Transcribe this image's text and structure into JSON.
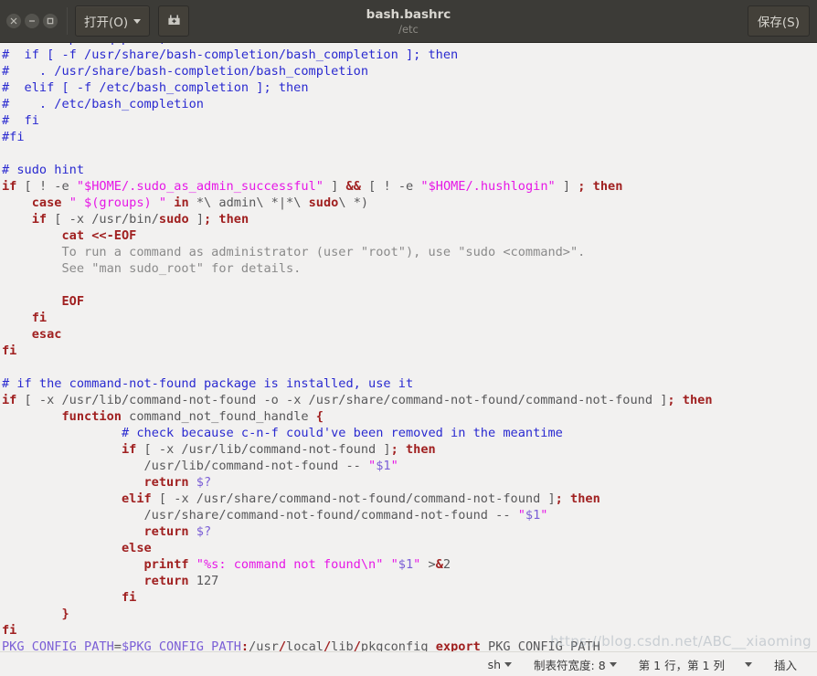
{
  "titlebar": {
    "window_controls": [
      {
        "name": "close",
        "glyph": "×"
      },
      {
        "name": "minimize",
        "glyph": "−"
      },
      {
        "name": "maximize",
        "glyph": "□"
      }
    ],
    "open_button": "打开(O)",
    "save_as_icon": "save-as-icon",
    "title": "bash.bashrc",
    "subtitle": "/etc",
    "save_button": "保存(S)"
  },
  "statusbar": {
    "language": "sh",
    "tab_width": "制表符宽度: 8",
    "cursor_position": "第 1 行，第 1 列",
    "insert_mode": "插入"
  },
  "watermark": "https://blog.csdn.net/ABC__xiaoming",
  "editor": {
    "lines": [
      [
        {
          "t": "#if ! shopt -oq posix; then",
          "c": "cm"
        }
      ],
      [
        {
          "t": "#  if [ -f /usr/share/bash-completion/bash_completion ]; then",
          "c": "cm"
        }
      ],
      [
        {
          "t": "#    . /usr/share/bash-completion/bash_completion",
          "c": "cm"
        }
      ],
      [
        {
          "t": "#  elif [ -f /etc/bash_completion ]; then",
          "c": "cm"
        }
      ],
      [
        {
          "t": "#    . /etc/bash_completion",
          "c": "cm"
        }
      ],
      [
        {
          "t": "#  fi",
          "c": "cm"
        }
      ],
      [
        {
          "t": "#fi",
          "c": "cm"
        }
      ],
      [
        {
          "t": "",
          "c": "df"
        }
      ],
      [
        {
          "t": "# sudo hint",
          "c": "cm"
        }
      ],
      [
        {
          "t": "if",
          "c": "kw"
        },
        {
          "t": " [ ",
          "c": "df"
        },
        {
          "t": "!",
          "c": "pl"
        },
        {
          "t": " -e ",
          "c": "df"
        },
        {
          "t": "\"$HOME/.sudo_as_admin_successful\"",
          "c": "st"
        },
        {
          "t": " ] ",
          "c": "df"
        },
        {
          "t": "&&",
          "c": "kw"
        },
        {
          "t": " [ ",
          "c": "df"
        },
        {
          "t": "!",
          "c": "pl"
        },
        {
          "t": " -e ",
          "c": "df"
        },
        {
          "t": "\"$HOME/.hushlogin\"",
          "c": "st"
        },
        {
          "t": " ] ",
          "c": "df"
        },
        {
          "t": ";",
          "c": "kw"
        },
        {
          "t": " ",
          "c": "df"
        },
        {
          "t": "then",
          "c": "kw"
        }
      ],
      [
        {
          "t": "    ",
          "c": "df"
        },
        {
          "t": "case",
          "c": "kw"
        },
        {
          "t": " ",
          "c": "df"
        },
        {
          "t": "\" $(groups) \"",
          "c": "st"
        },
        {
          "t": " ",
          "c": "df"
        },
        {
          "t": "in",
          "c": "kw"
        },
        {
          "t": " *\\ admin\\ *|*\\ ",
          "c": "df"
        },
        {
          "t": "sudo",
          "c": "kw"
        },
        {
          "t": "\\ *)",
          "c": "df"
        }
      ],
      [
        {
          "t": "    ",
          "c": "df"
        },
        {
          "t": "if",
          "c": "kw"
        },
        {
          "t": " [ -x /usr/bin/",
          "c": "df"
        },
        {
          "t": "sudo",
          "c": "kw"
        },
        {
          "t": " ]",
          "c": "df"
        },
        {
          "t": ";",
          "c": "kw"
        },
        {
          "t": " ",
          "c": "df"
        },
        {
          "t": "then",
          "c": "kw"
        }
      ],
      [
        {
          "t": "        ",
          "c": "df"
        },
        {
          "t": "cat <<-EOF",
          "c": "kw"
        }
      ],
      [
        {
          "t": "        To run a command as administrator (user \"root\"), use \"sudo <command>\".",
          "c": "hd"
        }
      ],
      [
        {
          "t": "        See \"man sudo_root\" for details.",
          "c": "hd"
        }
      ],
      [
        {
          "t": "",
          "c": "df"
        }
      ],
      [
        {
          "t": "        ",
          "c": "df"
        },
        {
          "t": "EOF",
          "c": "kw"
        }
      ],
      [
        {
          "t": "    ",
          "c": "df"
        },
        {
          "t": "fi",
          "c": "kw"
        }
      ],
      [
        {
          "t": "    ",
          "c": "df"
        },
        {
          "t": "esac",
          "c": "kw"
        }
      ],
      [
        {
          "t": "fi",
          "c": "kw"
        }
      ],
      [
        {
          "t": "",
          "c": "df"
        }
      ],
      [
        {
          "t": "# if the command-not-found package is installed, use it",
          "c": "cm"
        }
      ],
      [
        {
          "t": "if",
          "c": "kw"
        },
        {
          "t": " [ -x /usr/lib/command-not-found -o -x /usr/share/command-not-found/command-not-found ]",
          "c": "df"
        },
        {
          "t": ";",
          "c": "kw"
        },
        {
          "t": " ",
          "c": "df"
        },
        {
          "t": "then",
          "c": "kw"
        }
      ],
      [
        {
          "t": "        ",
          "c": "df"
        },
        {
          "t": "function",
          "c": "kw"
        },
        {
          "t": " command_not_found_handle ",
          "c": "df"
        },
        {
          "t": "{",
          "c": "kw"
        }
      ],
      [
        {
          "t": "                ",
          "c": "df"
        },
        {
          "t": "# check because c-n-f could've been removed in the meantime",
          "c": "cm"
        }
      ],
      [
        {
          "t": "                ",
          "c": "df"
        },
        {
          "t": "if",
          "c": "kw"
        },
        {
          "t": " [ -x /usr/lib/command-not-found ]",
          "c": "df"
        },
        {
          "t": ";",
          "c": "kw"
        },
        {
          "t": " ",
          "c": "df"
        },
        {
          "t": "then",
          "c": "kw"
        }
      ],
      [
        {
          "t": "                   /usr/lib/command-not-found -- ",
          "c": "df"
        },
        {
          "t": "\"",
          "c": "st"
        },
        {
          "t": "$1",
          "c": "vr"
        },
        {
          "t": "\"",
          "c": "st"
        }
      ],
      [
        {
          "t": "                   ",
          "c": "df"
        },
        {
          "t": "return",
          "c": "kw"
        },
        {
          "t": " ",
          "c": "df"
        },
        {
          "t": "$?",
          "c": "vr"
        }
      ],
      [
        {
          "t": "                ",
          "c": "df"
        },
        {
          "t": "elif",
          "c": "kw"
        },
        {
          "t": " [ -x /usr/share/command-not-found/command-not-found ]",
          "c": "df"
        },
        {
          "t": ";",
          "c": "kw"
        },
        {
          "t": " ",
          "c": "df"
        },
        {
          "t": "then",
          "c": "kw"
        }
      ],
      [
        {
          "t": "                   /usr/share/command-not-found/command-not-found -- ",
          "c": "df"
        },
        {
          "t": "\"",
          "c": "st"
        },
        {
          "t": "$1",
          "c": "vr"
        },
        {
          "t": "\"",
          "c": "st"
        }
      ],
      [
        {
          "t": "                   ",
          "c": "df"
        },
        {
          "t": "return",
          "c": "kw"
        },
        {
          "t": " ",
          "c": "df"
        },
        {
          "t": "$?",
          "c": "vr"
        }
      ],
      [
        {
          "t": "                ",
          "c": "df"
        },
        {
          "t": "else",
          "c": "kw"
        }
      ],
      [
        {
          "t": "                   ",
          "c": "df"
        },
        {
          "t": "printf",
          "c": "kw"
        },
        {
          "t": " ",
          "c": "df"
        },
        {
          "t": "\"%s: command not found\\n\"",
          "c": "st"
        },
        {
          "t": " ",
          "c": "df"
        },
        {
          "t": "\"",
          "c": "st"
        },
        {
          "t": "$1",
          "c": "vr"
        },
        {
          "t": "\"",
          "c": "st"
        },
        {
          "t": " >",
          "c": "df"
        },
        {
          "t": "&",
          "c": "kw"
        },
        {
          "t": "2",
          "c": "df"
        }
      ],
      [
        {
          "t": "                   ",
          "c": "df"
        },
        {
          "t": "return",
          "c": "kw"
        },
        {
          "t": " 127",
          "c": "df"
        }
      ],
      [
        {
          "t": "                ",
          "c": "df"
        },
        {
          "t": "fi",
          "c": "kw"
        }
      ],
      [
        {
          "t": "        ",
          "c": "df"
        },
        {
          "t": "}",
          "c": "kw"
        }
      ],
      [
        {
          "t": "fi",
          "c": "kw"
        }
      ],
      [
        {
          "t": "PKG_CONFIG_PATH",
          "c": "vr"
        },
        {
          "t": "=",
          "c": "df"
        },
        {
          "t": "$PKG_CONFIG_PATH",
          "c": "vr"
        },
        {
          "t": ":",
          "c": "kw"
        },
        {
          "t": "/usr",
          "c": "df"
        },
        {
          "t": "/",
          "c": "kw"
        },
        {
          "t": "local",
          "c": "df"
        },
        {
          "t": "/",
          "c": "kw"
        },
        {
          "t": "lib",
          "c": "df"
        },
        {
          "t": "/",
          "c": "kw"
        },
        {
          "t": "pkgconfig ",
          "c": "df"
        },
        {
          "t": "export",
          "c": "kw"
        },
        {
          "t": " PKG_CONFIG_PATH",
          "c": "df"
        }
      ]
    ]
  }
}
